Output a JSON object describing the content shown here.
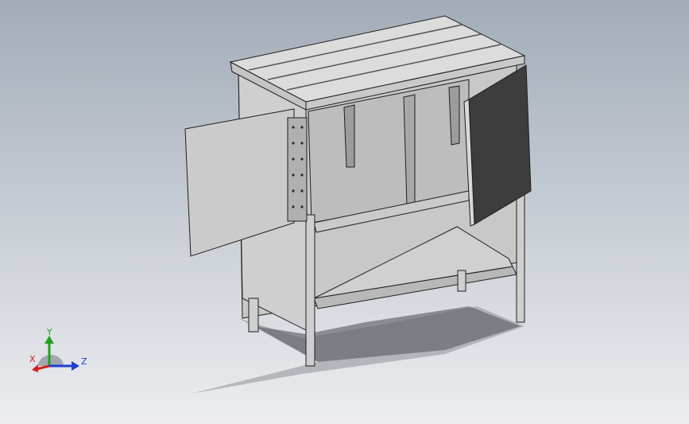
{
  "viewport": {
    "background_top": "#a2acb8",
    "background_bottom": "#ecedf0"
  },
  "model": {
    "part_color": "#d4d4d4",
    "dark_door_color": "#3d3d3d",
    "edge_color": "#1e1e1e"
  },
  "triad": {
    "x_label": "X",
    "y_label": "Y",
    "z_label": "Z",
    "x_color": "#d42020",
    "y_color": "#20a020",
    "z_color": "#2040d0"
  }
}
